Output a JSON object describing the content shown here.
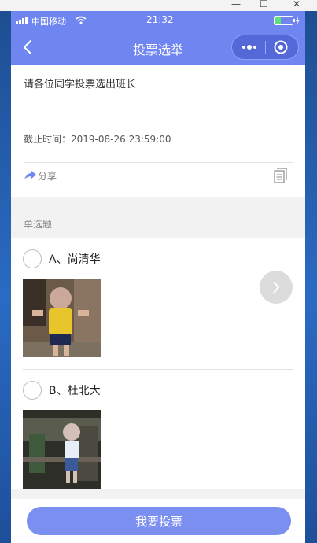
{
  "status": {
    "carrier": "中国移动",
    "time": "21:32"
  },
  "nav": {
    "title": "投票选举"
  },
  "vote": {
    "description": "请各位同学投票选出班长",
    "deadline_label": "截止时间：",
    "deadline_value": "2019-08-26 23:59:00",
    "share_label": "分享"
  },
  "question": {
    "type_label": "单选题"
  },
  "options": [
    {
      "label": "A、尚清华"
    },
    {
      "label": "B、杜北大"
    }
  ],
  "footer": {
    "vote_button": "我要投票"
  },
  "colors": {
    "accent": "#6f86f0",
    "button": "#7b8ff0"
  }
}
